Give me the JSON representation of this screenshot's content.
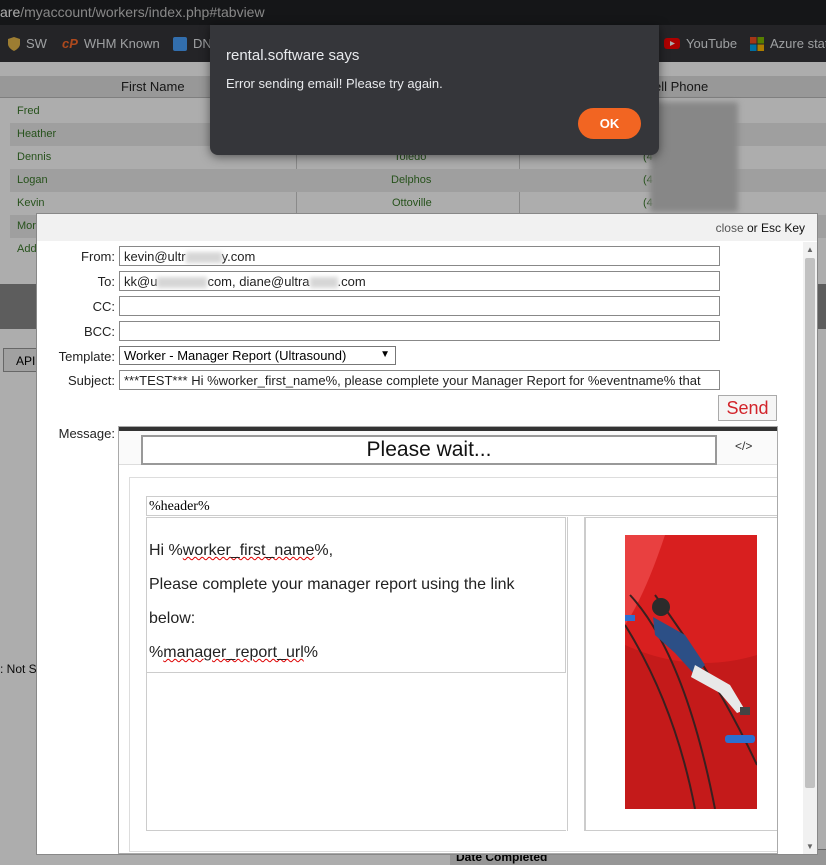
{
  "browser": {
    "url_host": "are",
    "url_path": "/myaccount/workers/index.php#tabview",
    "bookmarks": [
      {
        "label": "SW",
        "icon": "shield-icon",
        "color": "#e8b84a"
      },
      {
        "label": "WHM Known",
        "icon": "cpanel-icon",
        "color": "#ff6c2c"
      },
      {
        "label": "DN",
        "icon": "dn-icon",
        "color": "#4aa3ff"
      },
      {
        "label": "YouTube",
        "icon": "youtube-icon",
        "color": "#ff0000"
      },
      {
        "label": "Azure stat",
        "icon": "microsoft-icon",
        "color": "#7fba00"
      }
    ]
  },
  "grid": {
    "columns": {
      "first_name": "First Name",
      "cell_phone": "ell Phone"
    },
    "rows": [
      {
        "first": "Fred",
        "city": "",
        "phone": "("
      },
      {
        "first": "Heather",
        "city": "",
        "phone": "("
      },
      {
        "first": "Dennis",
        "city": "Toledo",
        "phone": "(4"
      },
      {
        "first": "Logan",
        "city": "Delphos",
        "phone": "(4"
      },
      {
        "first": "Kevin",
        "city": "Ottoville",
        "phone": "(4"
      },
      {
        "first": "Mor",
        "city": "",
        "phone": ""
      },
      {
        "first": "Add",
        "city": "",
        "phone": ""
      }
    ]
  },
  "background": {
    "api_tab": "API",
    "not_status": ": Not S",
    "date_completed": "Date Completed"
  },
  "modal": {
    "close_link": "close",
    "close_suffix": " or Esc Key",
    "labels": {
      "from": "From:",
      "to": "To:",
      "cc": "CC:",
      "bcc": "BCC:",
      "template": "Template:",
      "subject": "Subject:",
      "message": "Message:"
    },
    "from_pre": "kevin@ultr",
    "from_post": "y.com",
    "to_a": "kk@u",
    "to_b": "com, diane@ultra",
    "to_c": ".com",
    "cc": "",
    "bcc": "",
    "template_selected": "Worker - Manager Report (Ultrasound)",
    "subject": "***TEST*** Hi %worker_first_name%, please complete your Manager Report for %eventname% that",
    "send_label": "Send",
    "editor": {
      "status": "Please wait...",
      "code_label": "</>",
      "header_token": "%header%",
      "greeting_pre": "Hi %",
      "greeting_var": "worker_first_name",
      "greeting_post": "%,",
      "line2": "Please complete your manager report using the link below:",
      "url_pre": "%",
      "url_var": "manager_report_url",
      "url_post": "%"
    }
  },
  "dialog": {
    "title": "rental.software says",
    "message": "Error sending email! Please try again.",
    "ok_label": "OK"
  }
}
